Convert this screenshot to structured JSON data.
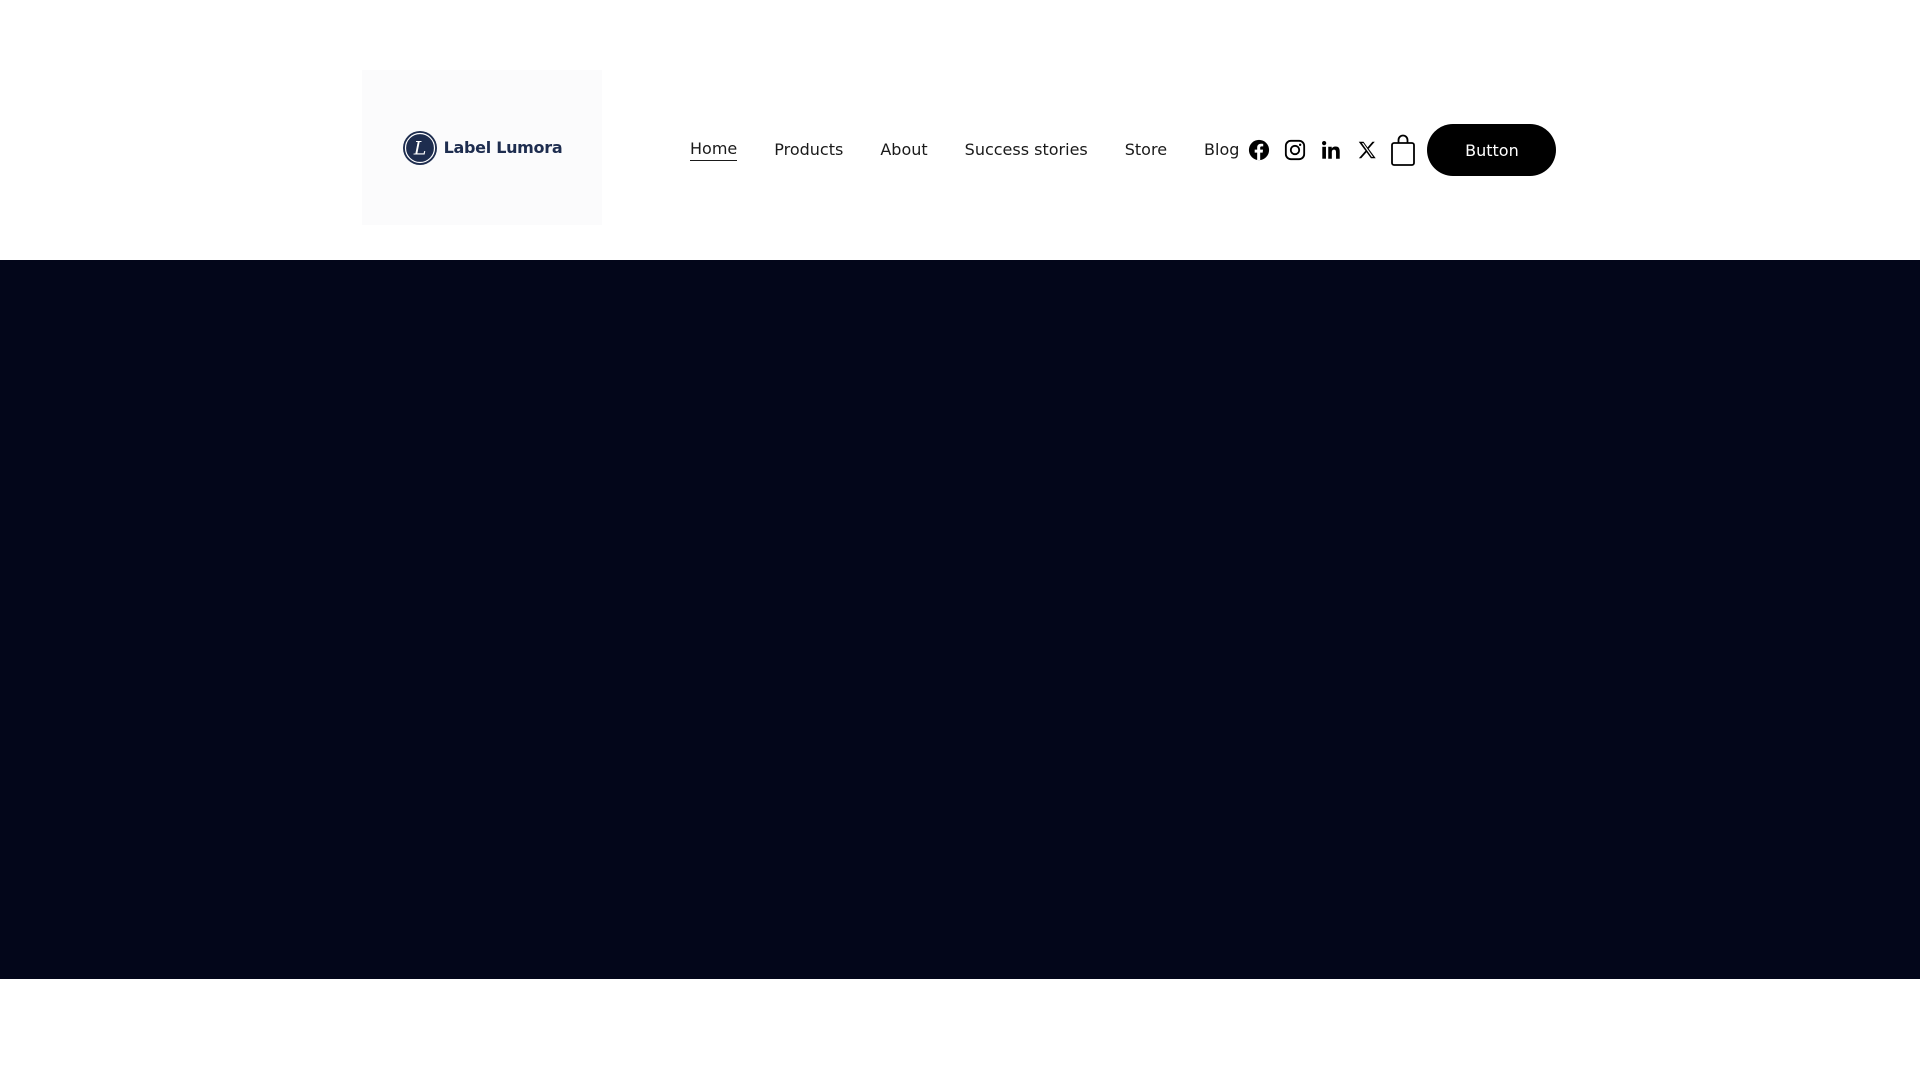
{
  "brand": {
    "name": "Label Lumora",
    "mark_letter": "L",
    "color": "#1e2d4f"
  },
  "nav": {
    "items": [
      {
        "label": "Home",
        "active": true
      },
      {
        "label": "Products",
        "active": false
      },
      {
        "label": "About",
        "active": false
      },
      {
        "label": "Success stories",
        "active": false
      },
      {
        "label": "Store",
        "active": false
      },
      {
        "label": "Blog",
        "active": false
      }
    ]
  },
  "social": {
    "icons": [
      "facebook-icon",
      "instagram-icon",
      "linkedin-icon",
      "x-icon"
    ]
  },
  "cart": {
    "icon": "shopping-bag-icon"
  },
  "cta": {
    "label": "Button",
    "bg": "#000000",
    "fg": "#ffffff"
  },
  "hero": {
    "bg": "#03061a"
  }
}
